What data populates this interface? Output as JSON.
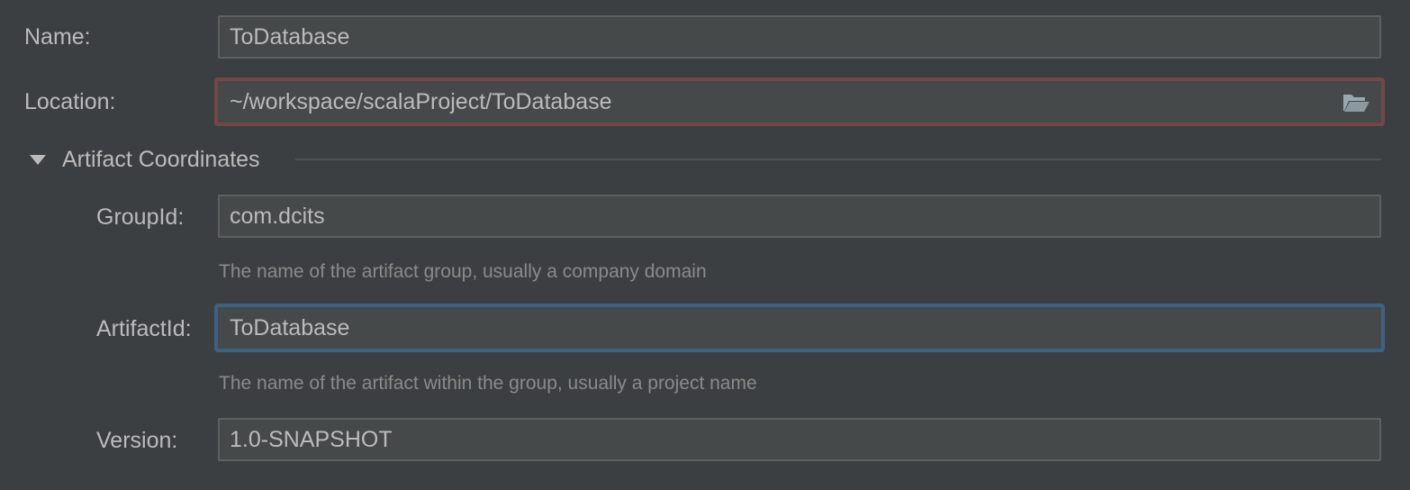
{
  "form": {
    "name": {
      "label": "Name:",
      "value": "ToDatabase"
    },
    "location": {
      "label": "Location:",
      "value": "~/workspace/scalaProject/ToDatabase",
      "icon": "folder-icon",
      "error_color": "#73464a"
    },
    "artifact_coordinates": {
      "title": "Artifact Coordinates",
      "expanded": true,
      "group_id": {
        "label": "GroupId:",
        "value": "com.dcits",
        "hint": "The name of the artifact group, usually a company domain"
      },
      "artifact_id": {
        "label": "ArtifactId:",
        "value": "ToDatabase",
        "hint": "The name of the artifact within the group, usually a project name",
        "focus_color": "#3d6185"
      },
      "version": {
        "label": "Version:",
        "value": "1.0-SNAPSHOT"
      }
    }
  }
}
